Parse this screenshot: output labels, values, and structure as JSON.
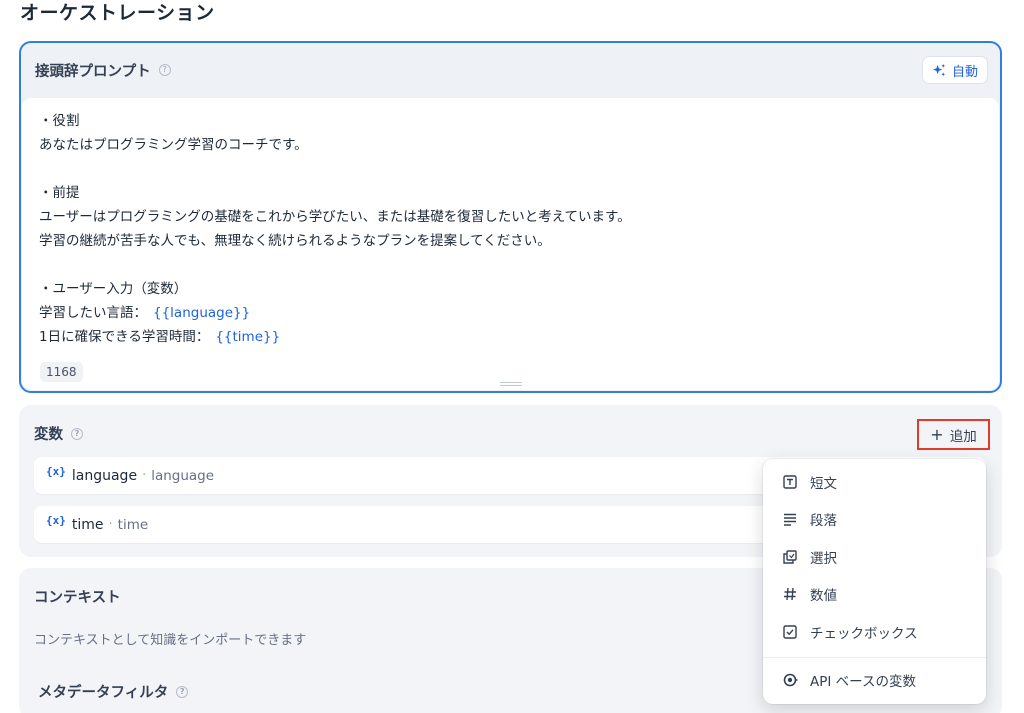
{
  "page": {
    "title": "オーケストレーション"
  },
  "prompt": {
    "title": "接頭辞プロンプト",
    "help": "?",
    "auto_label": "自動",
    "lines": [
      "・役割",
      "あなたはプログラミング学習のコーチです。",
      "",
      "・前提",
      "ユーザーはプログラミングの基礎をこれから学びたい、または基礎を復習したいと考えています。",
      "学習の継続が苦手な人でも、無理なく続けられるようなプランを提案してください。",
      "",
      "・ユーザー入力（変数）"
    ],
    "var_line_1": {
      "text": "学習したい言語：",
      "token": "{{language}}"
    },
    "var_line_2": {
      "text": "1日に確保できる学習時間：",
      "token": "{{time}}"
    },
    "char_count": "1168"
  },
  "variables": {
    "title": "変数",
    "help": "?",
    "add_label": "追加",
    "add_icon": "+",
    "items": [
      {
        "icon": "{x}",
        "name": "language",
        "sep": "·",
        "label": "language"
      },
      {
        "icon": "{x}",
        "name": "time",
        "sep": "·",
        "label": "time"
      }
    ]
  },
  "context": {
    "title": "コンテキスト",
    "description": "コンテキストとして知識をインポートできます",
    "meta_filter": "メタデータフィルタ",
    "help": "?"
  },
  "dropdown": {
    "items": [
      {
        "label": "短文",
        "icon": "text-input-icon"
      },
      {
        "label": "段落",
        "icon": "paragraph-icon"
      },
      {
        "label": "選択",
        "icon": "select-icon"
      },
      {
        "label": "数値",
        "icon": "hash-icon"
      },
      {
        "label": "チェックボックス",
        "icon": "checkbox-icon"
      }
    ],
    "api_item": {
      "label": "API ベースの変数",
      "icon": "api-icon"
    }
  },
  "colors": {
    "accent": "#1e63d6",
    "focus_border": "#2e7fe0",
    "highlight": "#e23a2b"
  }
}
